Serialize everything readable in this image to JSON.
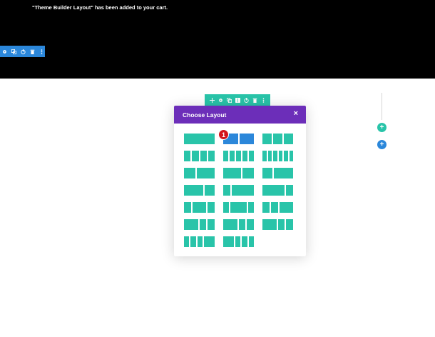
{
  "notice": {
    "text": "\"Theme Builder Layout\" has been added to your cart."
  },
  "section_toolbar": {
    "icons": [
      "gear-icon",
      "duplicate-icon",
      "power-icon",
      "trash-icon",
      "more-icon"
    ]
  },
  "row_toolbar": {
    "icons": [
      "move-icon",
      "gear-icon",
      "duplicate-icon",
      "columns-icon",
      "power-icon",
      "trash-icon",
      "more-icon"
    ]
  },
  "add_buttons": {
    "teal_label": "+",
    "blue_label": "+"
  },
  "modal": {
    "title": "Choose Layout",
    "close_label": "×",
    "selected_index": 1,
    "badge": "1",
    "layouts": [
      [
        1
      ],
      [
        1,
        1
      ],
      [
        1,
        1,
        1
      ],
      [
        1,
        1,
        1,
        1
      ],
      [
        1,
        1,
        1,
        1,
        1
      ],
      [
        1,
        1,
        1,
        1,
        1,
        1
      ],
      [
        2,
        3
      ],
      [
        3,
        2
      ],
      [
        1,
        2
      ],
      [
        2,
        1
      ],
      [
        1,
        3
      ],
      [
        3,
        1
      ],
      [
        1,
        2,
        1
      ],
      [
        1,
        3,
        1
      ],
      [
        1,
        1,
        2
      ],
      [
        2,
        1,
        1
      ],
      [
        2,
        1,
        1
      ],
      [
        2,
        1,
        1
      ],
      [
        1,
        1,
        1,
        2
      ],
      [
        2,
        1,
        1,
        1
      ]
    ]
  },
  "colors": {
    "teal": "#29c4a9",
    "blue": "#2b87da",
    "purple": "#6c2eb9",
    "badge_red": "#d3141c"
  }
}
